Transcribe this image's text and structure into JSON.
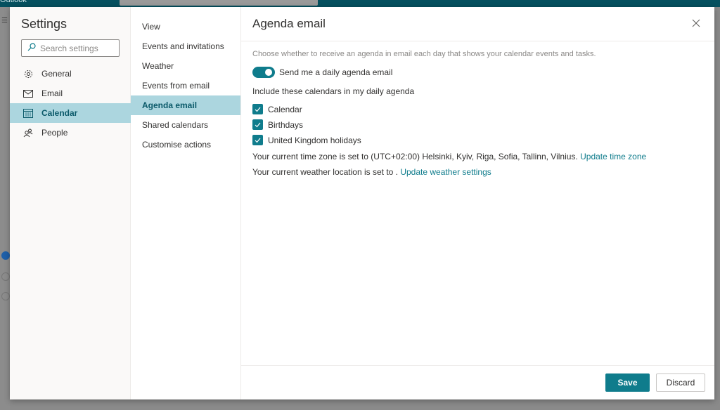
{
  "background_app": {
    "title": "Outlook"
  },
  "settings": {
    "title": "Settings",
    "search_placeholder": "Search settings",
    "categories": [
      {
        "label": "General",
        "icon": "gear-icon"
      },
      {
        "label": "Email",
        "icon": "mail-icon"
      },
      {
        "label": "Calendar",
        "icon": "calendar-icon",
        "active": true
      },
      {
        "label": "People",
        "icon": "people-icon"
      }
    ]
  },
  "subnav": {
    "items": [
      {
        "label": "View"
      },
      {
        "label": "Events and invitations"
      },
      {
        "label": "Weather"
      },
      {
        "label": "Events from email"
      },
      {
        "label": "Agenda email",
        "active": true
      },
      {
        "label": "Shared calendars"
      },
      {
        "label": "Customise actions"
      }
    ]
  },
  "content": {
    "title": "Agenda email",
    "description": "Choose whether to receive an agenda in email each day that shows your calendar events and tasks.",
    "toggle": {
      "label": "Send me a daily agenda email",
      "on": true
    },
    "include_label": "Include these calendars in my daily agenda",
    "calendars": [
      {
        "label": "Calendar",
        "checked": true
      },
      {
        "label": "Birthdays",
        "checked": true
      },
      {
        "label": "United Kingdom holidays",
        "checked": true
      }
    ],
    "timezone_text": "Your current time zone is set to (UTC+02:00) Helsinki, Kyiv, Riga, Sofia, Tallinn, Vilnius. ",
    "timezone_link": "Update time zone",
    "weather_text": "Your current weather location is set to . ",
    "weather_link": "Update weather settings"
  },
  "footer": {
    "save_label": "Save",
    "discard_label": "Discard"
  },
  "colors": {
    "accent": "#0f7c8c",
    "selected_bg": "#acd6df"
  }
}
